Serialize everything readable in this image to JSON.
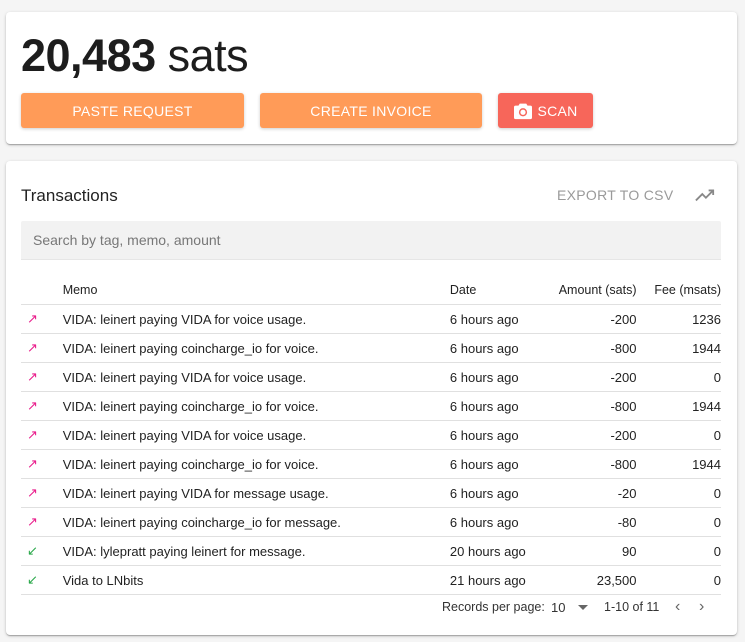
{
  "balance": {
    "amount": "20,483",
    "unit": "sats"
  },
  "actions": {
    "paste": "Paste Request",
    "invoice": "Create Invoice",
    "scan": "Scan"
  },
  "transactions": {
    "title": "Transactions",
    "export": "Export to CSV",
    "search_placeholder": "Search by tag, memo, amount",
    "columns": {
      "memo": "Memo",
      "date": "Date",
      "amount": "Amount (sats)",
      "fee": "Fee (msats)"
    },
    "rows": [
      {
        "dir": "out",
        "memo": "VIDA: leinert paying VIDA for voice usage.",
        "date": "6 hours ago",
        "amount": "-200",
        "fee": "1236"
      },
      {
        "dir": "out",
        "memo": "VIDA: leinert paying coincharge_io for voice.",
        "date": "6 hours ago",
        "amount": "-800",
        "fee": "1944"
      },
      {
        "dir": "out",
        "memo": "VIDA: leinert paying VIDA for voice usage.",
        "date": "6 hours ago",
        "amount": "-200",
        "fee": "0"
      },
      {
        "dir": "out",
        "memo": "VIDA: leinert paying coincharge_io for voice.",
        "date": "6 hours ago",
        "amount": "-800",
        "fee": "1944"
      },
      {
        "dir": "out",
        "memo": "VIDA: leinert paying VIDA for voice usage.",
        "date": "6 hours ago",
        "amount": "-200",
        "fee": "0"
      },
      {
        "dir": "out",
        "memo": "VIDA: leinert paying coincharge_io for voice.",
        "date": "6 hours ago",
        "amount": "-800",
        "fee": "1944"
      },
      {
        "dir": "out",
        "memo": "VIDA: leinert paying VIDA for message usage.",
        "date": "6 hours ago",
        "amount": "-20",
        "fee": "0"
      },
      {
        "dir": "out",
        "memo": "VIDA: leinert paying coincharge_io for message.",
        "date": "6 hours ago",
        "amount": "-80",
        "fee": "0"
      },
      {
        "dir": "in",
        "memo": "VIDA: lylepratt paying leinert for message.",
        "date": "20 hours ago",
        "amount": "90",
        "fee": "0"
      },
      {
        "dir": "in",
        "memo": "Vida to LNbits",
        "date": "21 hours ago",
        "amount": "23,500",
        "fee": "0"
      }
    ],
    "pagination": {
      "label": "Records per page:",
      "per_page": "10",
      "range": "1-10 of 11"
    }
  },
  "colors": {
    "orange": "#ff9b58",
    "red": "#f7665a",
    "outgoing": "#e91e8c",
    "incoming": "#2aa84a"
  },
  "icons": {
    "outgoing": "arrow-up-right-icon",
    "incoming": "arrow-down-left-icon",
    "scan": "camera-icon",
    "chart": "trending-up-icon"
  }
}
